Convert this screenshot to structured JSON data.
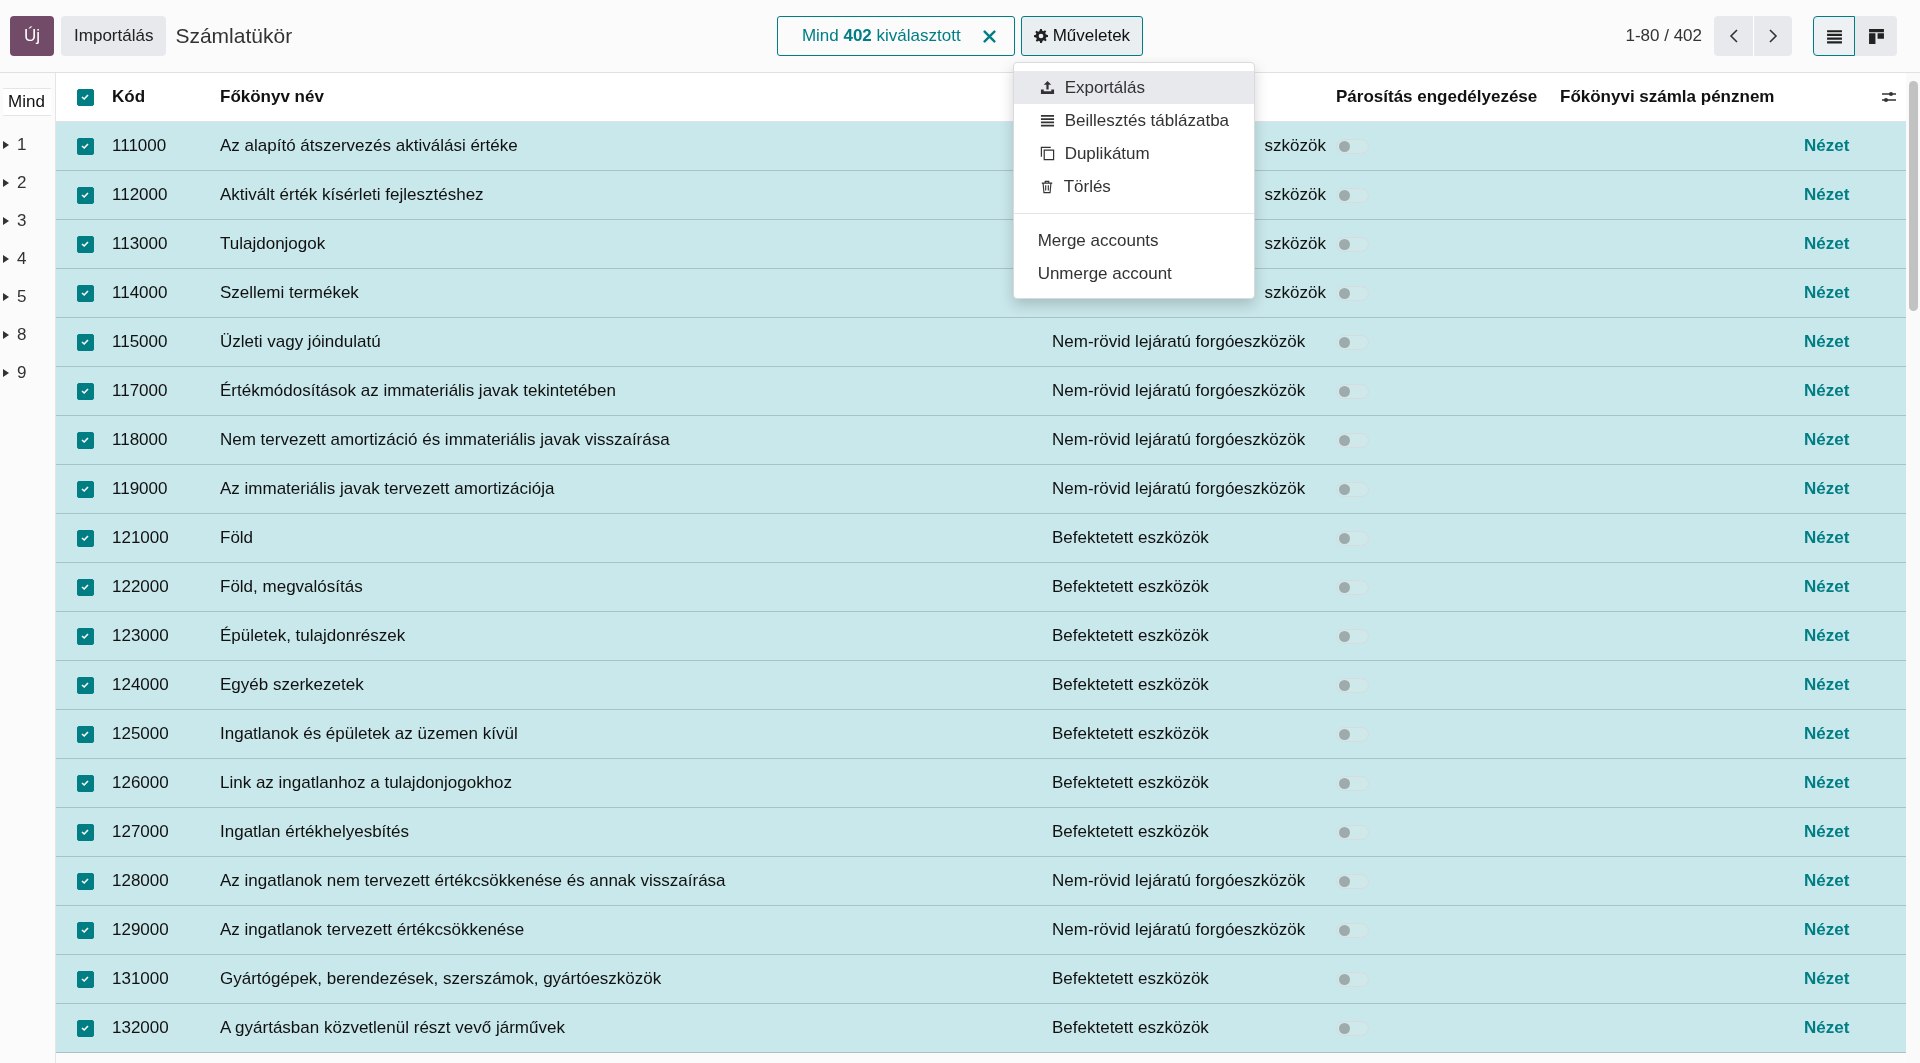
{
  "toolbar": {
    "new_button": "Új",
    "import_button": "Importálás",
    "title": "Számlatükör",
    "selection": "Mind **402** kiválasztott",
    "actions_button": "Műveletek",
    "pager": "1-80 / 402",
    "views": [
      {
        "kind": "list",
        "selected": true
      },
      {
        "kind": "kanban",
        "selected": false
      }
    ]
  },
  "actions_menu": {
    "groups": [
      [
        {
          "kind": "export",
          "label": "Exportálás",
          "highlighted": true
        },
        {
          "kind": "insert",
          "label": "Beillesztés táblázatba",
          "highlighted": false
        },
        {
          "kind": "duplicate",
          "label": "Duplikátum",
          "highlighted": false
        },
        {
          "kind": "delete",
          "label": "Törlés",
          "highlighted": false
        }
      ],
      [
        {
          "kind": "plain",
          "label": "Merge accounts",
          "highlighted": false
        },
        {
          "kind": "plain",
          "label": "Unmerge account",
          "highlighted": false
        }
      ]
    ]
  },
  "sidebar": {
    "header": "Mind",
    "groups": [
      {
        "label": "1",
        "expanded": false
      },
      {
        "label": "2",
        "expanded": false
      },
      {
        "label": "3",
        "expanded": false
      },
      {
        "label": "4",
        "expanded": false
      },
      {
        "label": "5",
        "expanded": false
      },
      {
        "label": "8",
        "expanded": false
      },
      {
        "label": "9",
        "expanded": false
      }
    ]
  },
  "table": {
    "select_all_checked": true,
    "headers": {
      "code": "Kód",
      "name": "Főkönyv név",
      "reconcile": "Párosítás engedélyezése",
      "currency": "Főkönyvi számla pénznem"
    },
    "rows": [
      {
        "checked": true,
        "code": "111000",
        "name": "Az alapító átszervezés aktiválási értéke",
        "type": "szközök",
        "type_cut": true,
        "reconcile": false,
        "action": "Nézet"
      },
      {
        "checked": true,
        "code": "112000",
        "name": "Aktivált érték kísérleti fejlesztéshez",
        "type": "szközök",
        "type_cut": true,
        "reconcile": false,
        "action": "Nézet"
      },
      {
        "checked": true,
        "code": "113000",
        "name": "Tulajdonjogok",
        "type": "szközök",
        "type_cut": true,
        "reconcile": false,
        "action": "Nézet"
      },
      {
        "checked": true,
        "code": "114000",
        "name": "Szellemi termékek",
        "type": "szközök",
        "type_cut": true,
        "reconcile": false,
        "action": "Nézet"
      },
      {
        "checked": true,
        "code": "115000",
        "name": "Üzleti vagy jóindulatú",
        "type": "Nem-rövid lejáratú forgóeszközök",
        "type_cut": false,
        "reconcile": false,
        "action": "Nézet"
      },
      {
        "checked": true,
        "code": "117000",
        "name": "Értékmódosítások az immateriális javak tekintetében",
        "type": "Nem-rövid lejáratú forgóeszközök",
        "type_cut": false,
        "reconcile": false,
        "action": "Nézet"
      },
      {
        "checked": true,
        "code": "118000",
        "name": "Nem tervezett amortizáció és immateriális javak visszaírása",
        "type": "Nem-rövid lejáratú forgóeszközök",
        "type_cut": false,
        "reconcile": false,
        "action": "Nézet"
      },
      {
        "checked": true,
        "code": "119000",
        "name": "Az immateriális javak tervezett amortizációja",
        "type": "Nem-rövid lejáratú forgóeszközök",
        "type_cut": false,
        "reconcile": false,
        "action": "Nézet"
      },
      {
        "checked": true,
        "code": "121000",
        "name": "Föld",
        "type": "Befektetett eszközök",
        "type_cut": false,
        "reconcile": false,
        "action": "Nézet"
      },
      {
        "checked": true,
        "code": "122000",
        "name": "Föld, megvalósítás",
        "type": "Befektetett eszközök",
        "type_cut": false,
        "reconcile": false,
        "action": "Nézet"
      },
      {
        "checked": true,
        "code": "123000",
        "name": "Épületek, tulajdonrészek",
        "type": "Befektetett eszközök",
        "type_cut": false,
        "reconcile": false,
        "action": "Nézet"
      },
      {
        "checked": true,
        "code": "124000",
        "name": "Egyéb szerkezetek",
        "type": "Befektetett eszközök",
        "type_cut": false,
        "reconcile": false,
        "action": "Nézet"
      },
      {
        "checked": true,
        "code": "125000",
        "name": "Ingatlanok és épületek az üzemen kívül",
        "type": "Befektetett eszközök",
        "type_cut": false,
        "reconcile": false,
        "action": "Nézet"
      },
      {
        "checked": true,
        "code": "126000",
        "name": "Link az ingatlanhoz a tulajdonjogokhoz",
        "type": "Befektetett eszközök",
        "type_cut": false,
        "reconcile": false,
        "action": "Nézet"
      },
      {
        "checked": true,
        "code": "127000",
        "name": "Ingatlan értékhelyesbítés",
        "type": "Befektetett eszközök",
        "type_cut": false,
        "reconcile": false,
        "action": "Nézet"
      },
      {
        "checked": true,
        "code": "128000",
        "name": "Az ingatlanok nem tervezett értékcsökkenése és annak visszaírása",
        "type": "Nem-rövid lejáratú forgóeszközök",
        "type_cut": false,
        "reconcile": false,
        "action": "Nézet"
      },
      {
        "checked": true,
        "code": "129000",
        "name": "Az ingatlanok tervezett értékcsökkenése",
        "type": "Nem-rövid lejáratú forgóeszközök",
        "type_cut": false,
        "reconcile": false,
        "action": "Nézet"
      },
      {
        "checked": true,
        "code": "131000",
        "name": "Gyártógépek, berendezések, szerszámok, gyártóeszközök",
        "type": "Befektetett eszközök",
        "type_cut": false,
        "reconcile": false,
        "action": "Nézet"
      },
      {
        "checked": true,
        "code": "132000",
        "name": "A gyártásban közvetlenül részt vevő járművek",
        "type": "Befektetett eszközök",
        "type_cut": false,
        "reconcile": false,
        "action": "Nézet"
      }
    ]
  }
}
